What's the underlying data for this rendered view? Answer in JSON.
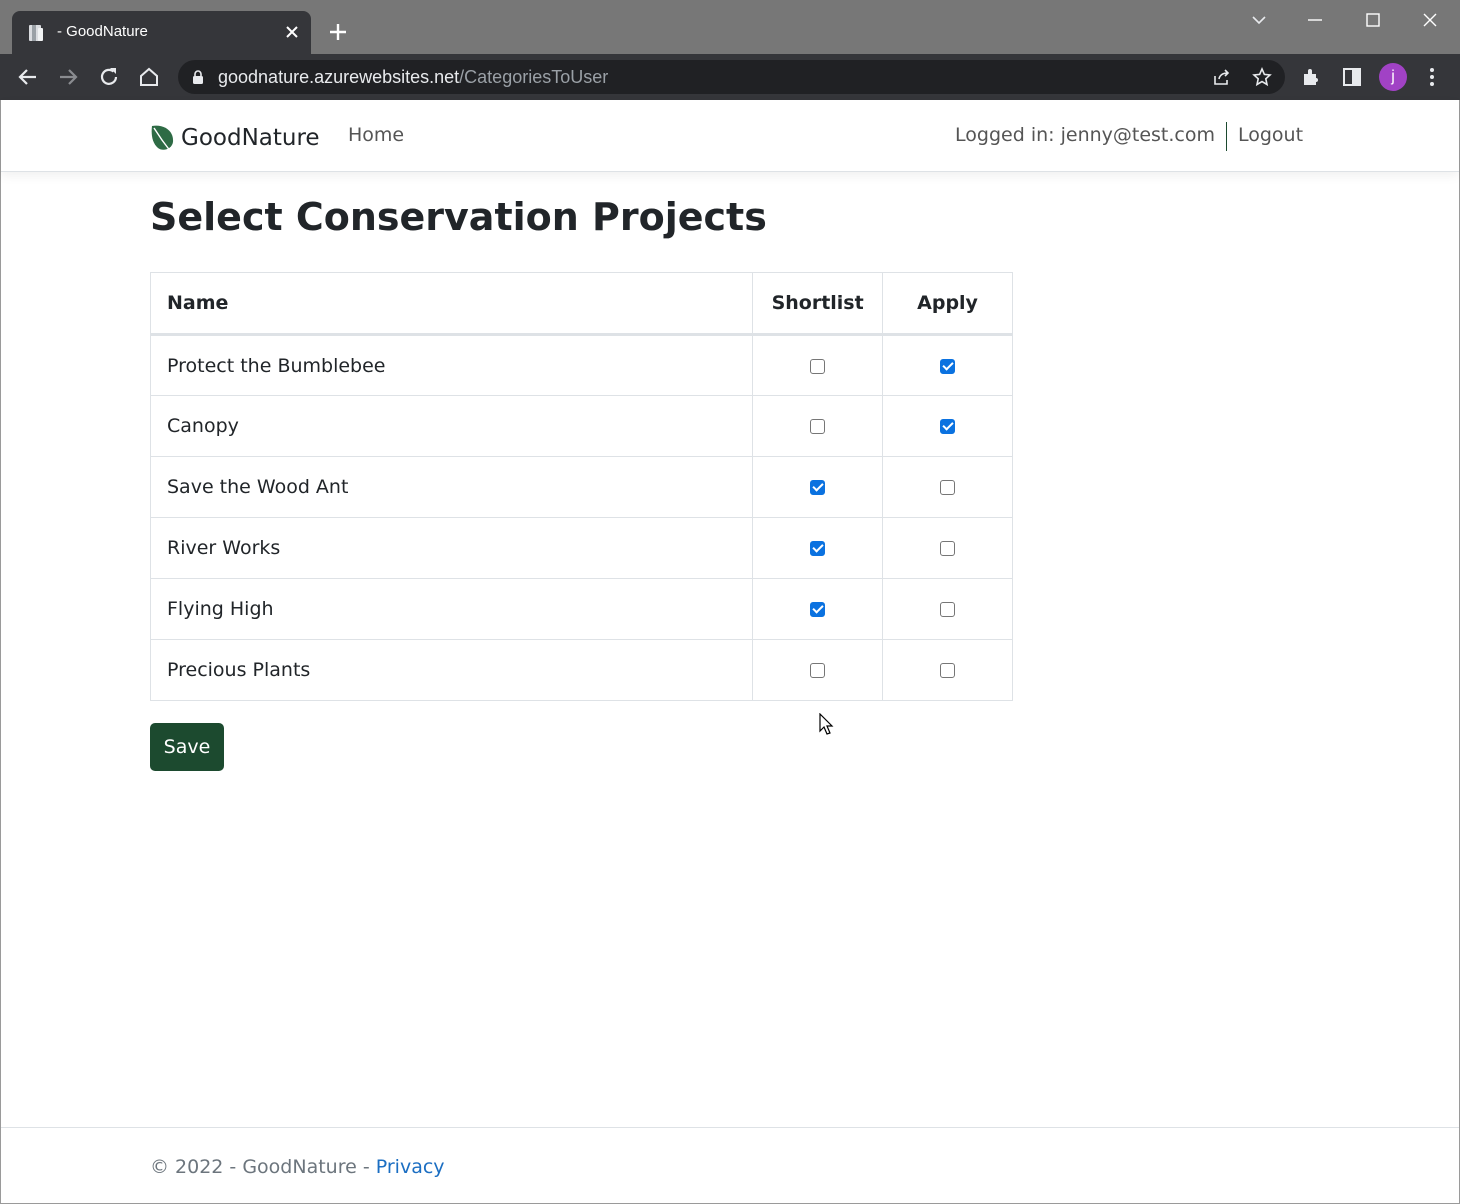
{
  "browser": {
    "tab_title": "- GoodNature",
    "url_host": "goodnature.azurewebsites.net",
    "url_path": "/CategoriesToUser",
    "avatar_letter": "j",
    "icons": [
      "favicon-icon",
      "close-icon",
      "plus-icon",
      "chevron-down-icon",
      "minimize-icon",
      "maximize-icon",
      "close-window-icon",
      "back-icon",
      "forward-icon",
      "reload-icon",
      "home-icon",
      "lock-icon",
      "share-icon",
      "star-icon",
      "extensions-icon",
      "side-panel-icon",
      "menu-icon"
    ]
  },
  "navbar": {
    "brand": "GoodNature",
    "home": "Home",
    "logged_in": "Logged in: jenny@test.com",
    "logout": "Logout",
    "brand_color": "#1c4a2f"
  },
  "page": {
    "title": "Select Conservation Projects",
    "table": {
      "headers": {
        "name": "Name",
        "shortlist": "Shortlist",
        "apply": "Apply"
      },
      "rows": [
        {
          "name": "Protect the Bumblebee",
          "shortlist": false,
          "apply": true
        },
        {
          "name": "Canopy",
          "shortlist": false,
          "apply": true
        },
        {
          "name": "Save the Wood Ant",
          "shortlist": true,
          "apply": false
        },
        {
          "name": "River Works",
          "shortlist": true,
          "apply": false
        },
        {
          "name": "Flying High",
          "shortlist": true,
          "apply": false
        },
        {
          "name": "Precious Plants",
          "shortlist": false,
          "apply": false
        }
      ]
    },
    "save_label": "Save",
    "save_color": "#1c4a2f",
    "checkbox_color": "#0b72e0"
  },
  "footer": {
    "copyright": "© 2022 - GoodNature - ",
    "privacy": "Privacy"
  }
}
